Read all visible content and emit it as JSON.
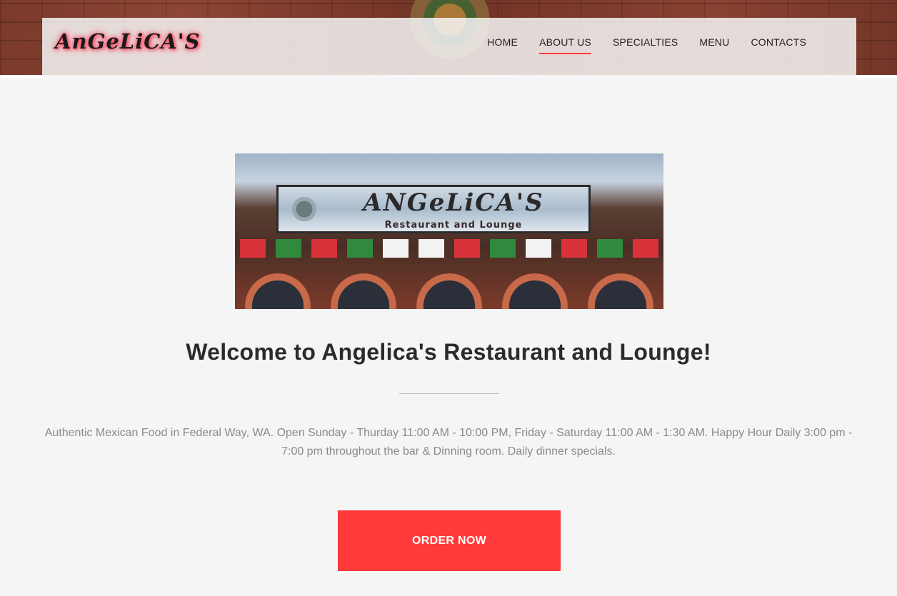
{
  "header": {
    "logo_text": "AnGeLiCA'S",
    "nav": [
      {
        "label": "HOME",
        "active": false
      },
      {
        "label": "ABOUT US",
        "active": true
      },
      {
        "label": "SPECIALTIES",
        "active": false
      },
      {
        "label": "MENU",
        "active": false
      },
      {
        "label": "CONTACTS",
        "active": false
      }
    ]
  },
  "hero_photo": {
    "sign_title": "ANGeLiCA'S",
    "sign_subtitle": "Restaurant and Lounge"
  },
  "main": {
    "welcome_title": "Welcome to Angelica's Restaurant and Lounge!",
    "description": "Authentic Mexican Food in Federal Way, WA. Open Sunday - Thurday 11:00 AM - 10:00 PM, Friday - Saturday 11:00 AM - 1:30 AM. Happy Hour Daily 3:00 pm - 7:00 pm throughout the bar & Dinning room. Daily dinner specials.",
    "order_button": "ORDER NOW"
  },
  "colors": {
    "accent": "#ff3a3a",
    "background": "#f5f5f5",
    "text_muted": "#8a8a8a"
  }
}
